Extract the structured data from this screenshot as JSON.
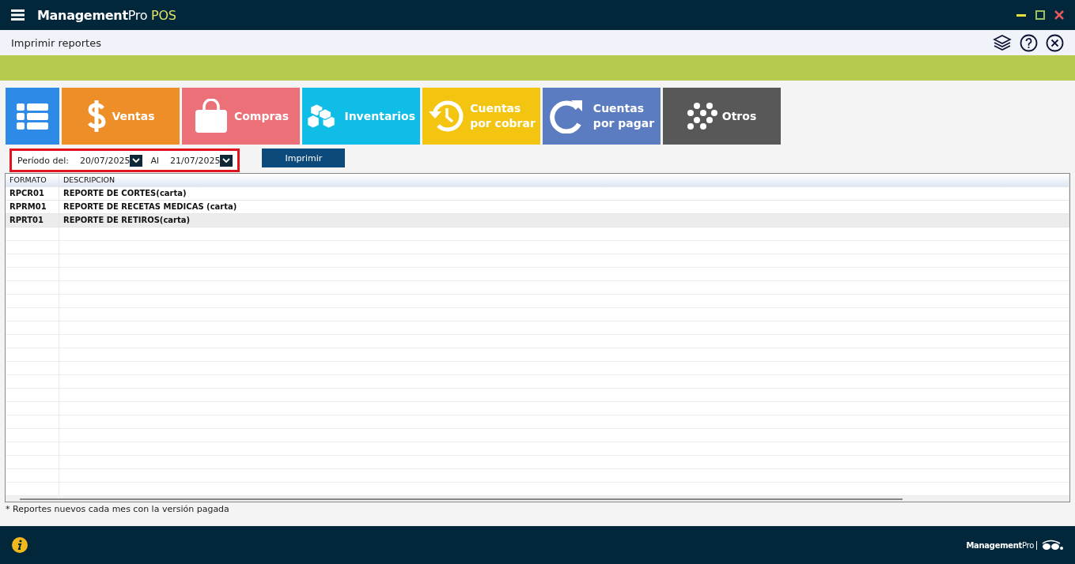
{
  "app_bar": {
    "brand": "Management",
    "brand_suffix": "Pro",
    "product": "POS"
  },
  "page": {
    "title": "Imprimir reportes"
  },
  "tiles": [
    {
      "kind": "list",
      "color": "#2d8ae6"
    },
    {
      "kind": "dollar",
      "label": "Ventas",
      "color": "#ee8e28"
    },
    {
      "kind": "bag",
      "label": "Compras",
      "color": "#ec7078"
    },
    {
      "kind": "boxes",
      "label": "Inventarios",
      "color": "#0fbde6"
    },
    {
      "kind": "history",
      "label": "Cuentas por cobrar",
      "color": "#f4c510"
    },
    {
      "kind": "redo",
      "label": "Cuentas por pagar",
      "color": "#5b7cc0"
    },
    {
      "kind": "dots",
      "label": "Otros",
      "color": "#585858"
    }
  ],
  "filter": {
    "from_label": "Período del:",
    "from_value": "20/07/2025",
    "to_label": "Al",
    "to_value": "21/07/2025"
  },
  "print_button": "Imprimir",
  "table": {
    "columns": [
      "FORMATO",
      "DESCRIPCION"
    ],
    "rows": [
      {
        "cells": [
          "RPCR01",
          "REPORTE DE CORTES(carta)"
        ],
        "selected": false
      },
      {
        "cells": [
          "RPRM01",
          "REPORTE DE RECETAS MEDICAS (carta)"
        ],
        "selected": false
      },
      {
        "cells": [
          "RPRT01",
          "REPORTE DE RETIROS(carta)"
        ],
        "selected": true
      }
    ]
  },
  "footnote": "* Reportes nuevos cada mes con la versión pagada",
  "footer": {
    "logo_text": "**Management**Pro"
  }
}
